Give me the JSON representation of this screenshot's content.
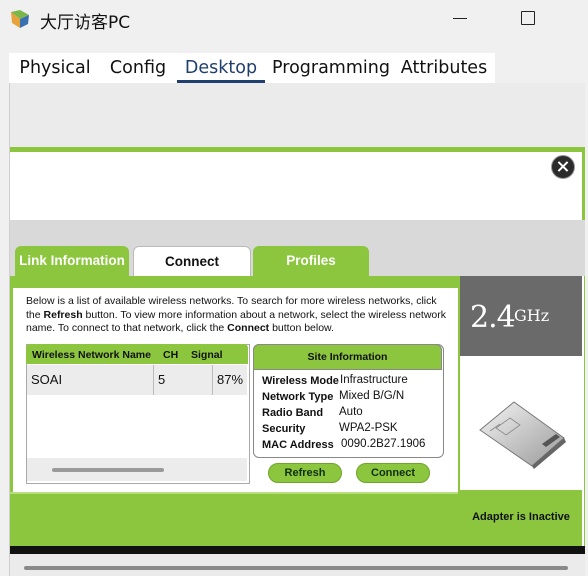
{
  "window": {
    "title": "大厅访客PC"
  },
  "tabs": [
    {
      "label": "Physical",
      "active": false
    },
    {
      "label": "Config",
      "active": false
    },
    {
      "label": "Desktop",
      "active": true
    },
    {
      "label": "Programming",
      "active": false
    },
    {
      "label": "Attributes",
      "active": false
    }
  ],
  "pc_wireless": {
    "tabs": [
      {
        "label": "Link Information",
        "active": false
      },
      {
        "label": "Connect",
        "active": true
      },
      {
        "label": "Profiles",
        "active": false
      }
    ],
    "description": {
      "part1": "Below is a list of available wireless networks. To search for more wireless networks, click the ",
      "refresh_word": "Refresh",
      "part2": " button. To view more information about a network, select the wireless network name. To connect to that network, click the ",
      "connect_word": "Connect",
      "part3": " button below."
    },
    "network_table": {
      "headers": {
        "name": "Wireless Network Name",
        "ch": "CH",
        "signal": "Signal"
      },
      "rows": [
        {
          "name": "SOAI",
          "ch": "5",
          "signal": "87%"
        }
      ]
    },
    "site_information": {
      "title": "Site Information",
      "fields": [
        {
          "label": "Wireless Mode",
          "value": "Infrastructure"
        },
        {
          "label": "Network Type",
          "value": "Mixed B/G/N"
        },
        {
          "label": "Radio Band",
          "value": "Auto"
        },
        {
          "label": "Security",
          "value": "WPA2-PSK"
        },
        {
          "label": "MAC Address",
          "value": "0090.2B27.1906"
        }
      ]
    },
    "buttons": {
      "refresh": "Refresh",
      "connect": "Connect"
    },
    "band": {
      "value": "2.4",
      "unit": "GHz"
    },
    "adapter_status": "Adapter is Inactive"
  },
  "colors": {
    "accent": "#8cc63f",
    "tab_underline": "#1f3f6e"
  }
}
